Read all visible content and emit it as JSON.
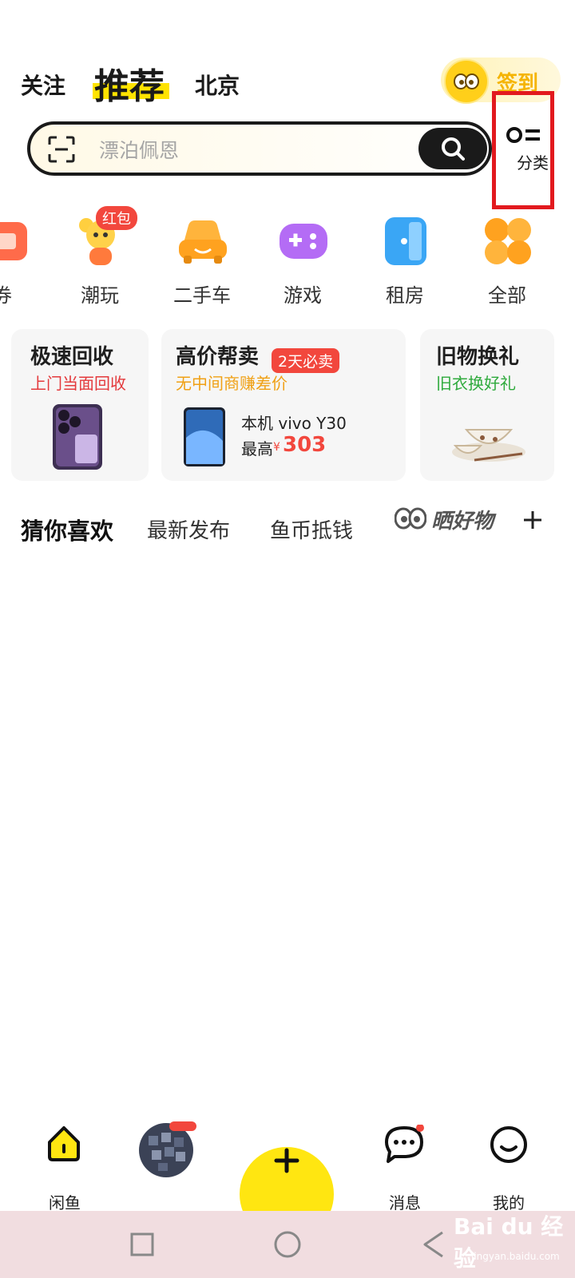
{
  "header": {
    "tabs": [
      "关注",
      "推荐",
      "北京"
    ],
    "signin_label": "签到"
  },
  "search": {
    "placeholder": "漂泊佩恩"
  },
  "category": {
    "label": "分类"
  },
  "quick_entries": [
    {
      "label": "券",
      "icon": "coupon-icon"
    },
    {
      "label": "潮玩",
      "icon": "toy-bear-icon",
      "badge": "红包"
    },
    {
      "label": "二手车",
      "icon": "car-icon"
    },
    {
      "label": "游戏",
      "icon": "gamepad-icon"
    },
    {
      "label": "租房",
      "icon": "door-icon"
    },
    {
      "label": "全部",
      "icon": "all-grid-icon"
    }
  ],
  "cards": {
    "recycle": {
      "title": "极速回收",
      "subtitle": "上门当面回收"
    },
    "sell": {
      "title": "高价帮卖",
      "tag": "2天必卖",
      "subtitle": "无中间商赚差价",
      "product": "本机 vivo Y30",
      "price_prefix": "最高",
      "currency": "¥",
      "price": "303"
    },
    "swap": {
      "title": "旧物换礼",
      "subtitle": "旧衣换好礼"
    }
  },
  "feed_tabs": [
    "猜你喜欢",
    "最新发布",
    "鱼币抵钱",
    "晒好物"
  ],
  "bottom_nav": {
    "home": "闲鱼",
    "messages": "消息",
    "mine": "我的"
  },
  "watermark": {
    "brand": "Bai du 经验",
    "url": "jingyan.baidu.com"
  },
  "colors": {
    "accent_yellow": "#ffe611",
    "highlight_red": "#e2191e",
    "price_red": "#f2473d"
  }
}
